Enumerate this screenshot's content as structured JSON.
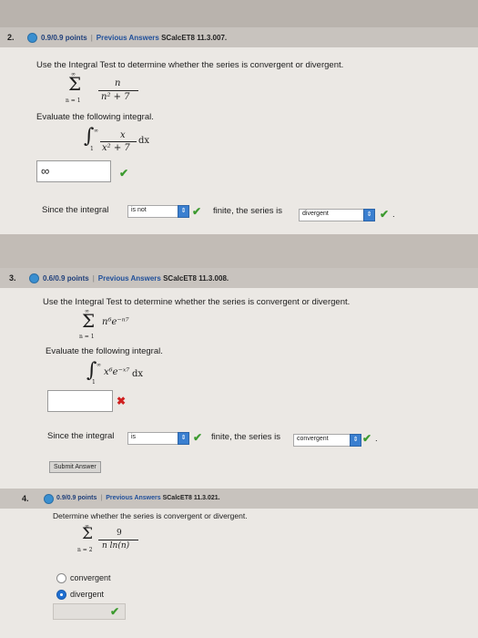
{
  "q2": {
    "number": "2.",
    "points": "0.9/0.9 points",
    "prev_answers": "Previous Answers",
    "code": "SCalcET8 11.3.007.",
    "prompt": "Use the Integral Test to determine whether the series is convergent or divergent.",
    "series_num": "n",
    "series_den": "n² + 7",
    "sum_top": "∞",
    "sum_bottom": "n = 1",
    "integral_prompt": "Evaluate the following integral.",
    "int_lower": "1",
    "int_upper": "∞",
    "integrand_num": "x",
    "integrand_den": "x² + 7",
    "dx": "dx",
    "answer_value": "∞",
    "since_text": "Since the integral",
    "select1_value": "is not",
    "finite_text": "finite, the series is",
    "select2_value": "divergent",
    "end_period": "."
  },
  "q3": {
    "number": "3.",
    "points": "0.6/0.9 points",
    "prev_answers": "Previous Answers",
    "code": "SCalcET8 11.3.008.",
    "prompt": "Use the Integral Test to determine whether the series is convergent or divergent.",
    "sum_top": "∞",
    "sum_bottom": "n = 1",
    "series_term": "n⁶e⁻ⁿ⁷",
    "integral_prompt": "Evaluate the following integral.",
    "int_lower": "1",
    "int_upper": "∞",
    "integrand": "x⁶e⁻ˣ⁷",
    "dx": "dx",
    "answer_value": "",
    "since_text": "Since the integral",
    "select1_value": "is",
    "finite_text": "finite, the series is",
    "select2_value": "convergent",
    "end_period": ".",
    "submit_label": "Submit Answer"
  },
  "q4": {
    "number": "4.",
    "points": "0.9/0.9 points",
    "prev_answers": "Previous Answers",
    "code": "SCalcET8 11.3.021.",
    "prompt": "Determine whether the series is convergent or divergent.",
    "sum_top": "∞",
    "sum_bottom": "n = 2",
    "series_num": "9",
    "series_den": "n ln(n)",
    "options": [
      "convergent",
      "divergent"
    ],
    "selected_option": "divergent"
  },
  "icons": {
    "check": "check-icon",
    "cross": "x-icon",
    "dropdown": "dropdown-arrow-icon",
    "points": "points-circle-icon"
  },
  "colors": {
    "check": "#3c9a2f",
    "cross": "#d02020",
    "accent": "#3a7fd0"
  }
}
